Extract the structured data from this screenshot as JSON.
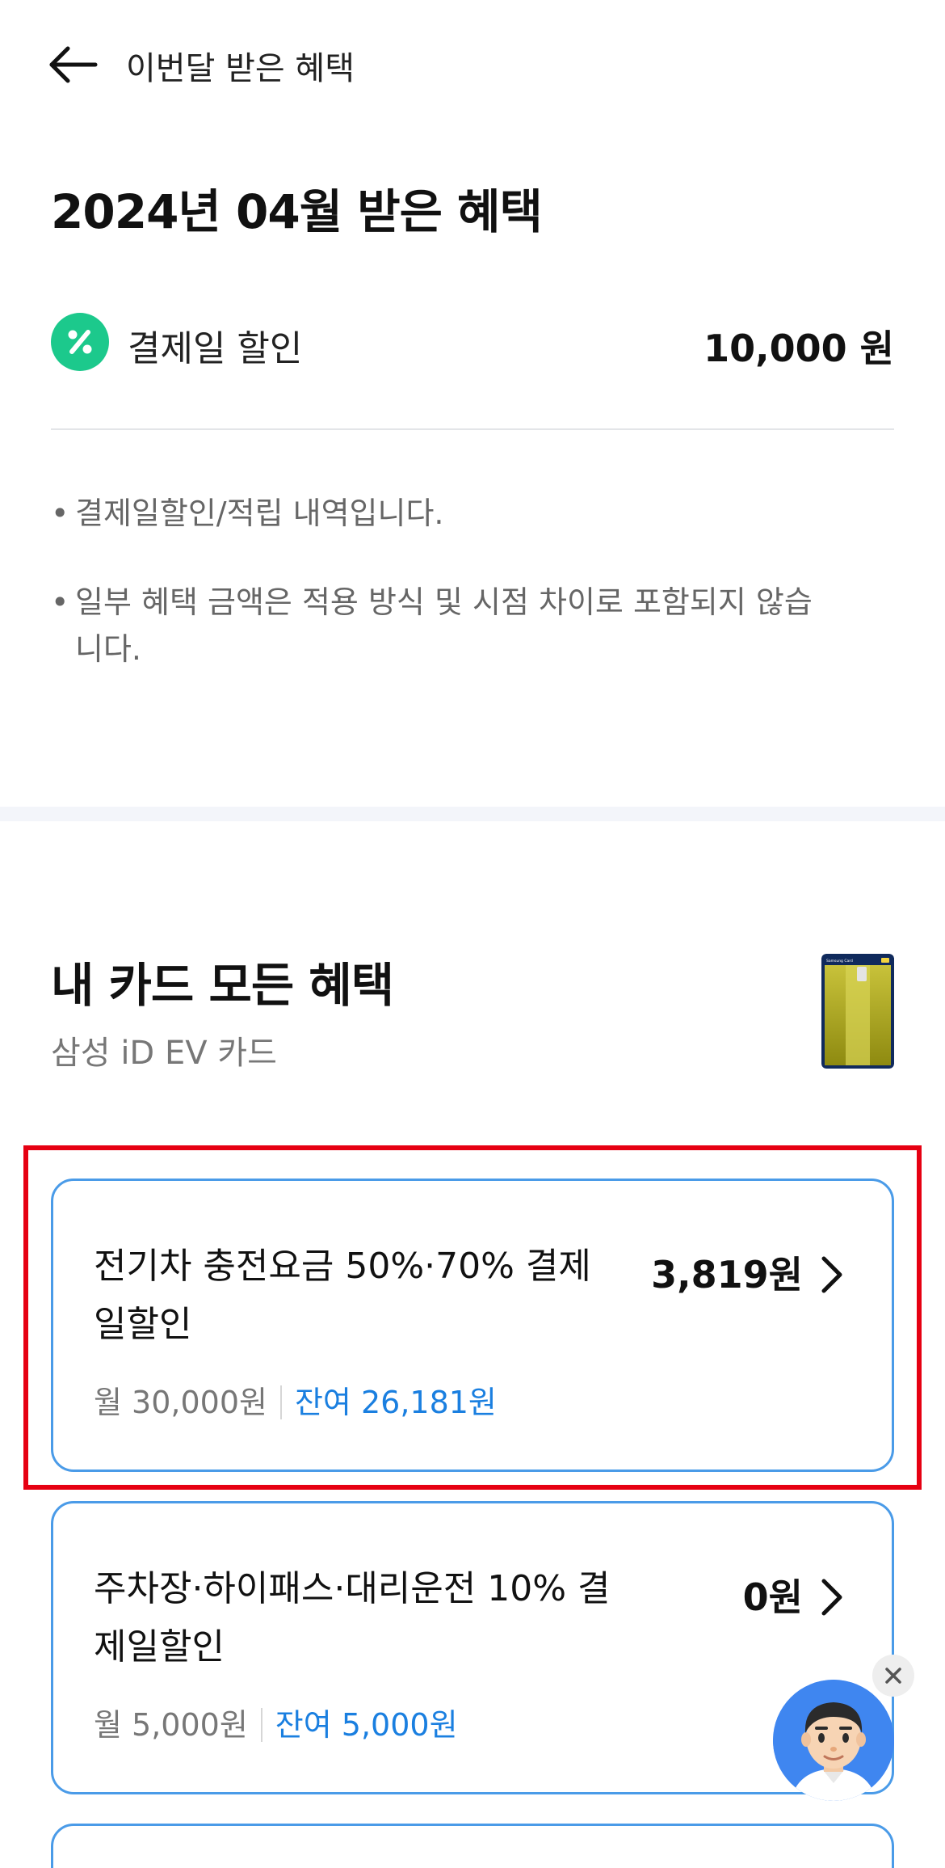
{
  "header": {
    "title": "이번달 받은 혜택",
    "back_icon": "arrow-left-icon"
  },
  "summary": {
    "month_title": "2024년 04월 받은 혜택",
    "discount_label": "결제일 할인",
    "discount_amount": "10,000 원",
    "icon": "percent-icon",
    "icon_color": "#1cc98c"
  },
  "notes": [
    "결제일할인/적립 내역입니다.",
    "일부 혜택 금액은 적용 방식 및 시점 차이로 포함되지 않습니다."
  ],
  "cards_section": {
    "title": "내 카드 모든 혜택",
    "card_name": "삼성 iD EV 카드",
    "card_thumb_text": "Samsung Card"
  },
  "benefits": [
    {
      "name": "전기차 충전요금 50%·70% 결제일할인",
      "amount": "3,819원",
      "limit": "월 30,000원",
      "remaining": "잔여 26,181원"
    },
    {
      "name": "주차장·하이패스·대리운전 10% 결제일할인",
      "amount": "0원",
      "limit": "월 5,000원",
      "remaining": "잔여 5,000원"
    }
  ],
  "colors": {
    "accent_blue": "#1a7fe0",
    "card_border": "#4a9be8",
    "highlight_red": "#e60012"
  }
}
